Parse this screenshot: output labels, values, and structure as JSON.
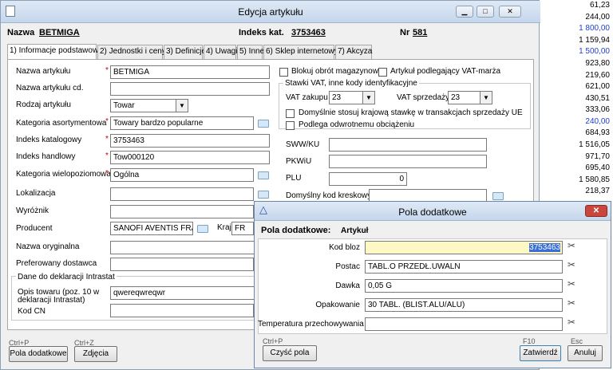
{
  "background": {
    "numbers": [
      "61,23",
      "244,00",
      "1 800,00",
      "1 159,94",
      "1 500,00",
      "923,80",
      "219,60",
      "621,00",
      "430,51",
      "333,06",
      "240,00",
      "684,93",
      "1 516,05",
      "971,70",
      "695,40",
      "1 580,85",
      "218,37"
    ],
    "blue_indices": [
      2,
      4,
      10
    ]
  },
  "main": {
    "title": "Edycja artykułu",
    "header": {
      "name_label": "Nazwa",
      "name_value": "BETMIGA",
      "index_label": "Indeks kat.",
      "index_value": "3753463",
      "nr_label": "Nr",
      "nr_value": "581"
    },
    "tabs": [
      "1) Informacje podstawowe",
      "2) Jednostki i ceny",
      "3) Definicje",
      "4) Uwagi",
      "5) Inne",
      "6) Sklep internetowy",
      "7) Akcyza"
    ],
    "fields": {
      "nazwa_label": "Nazwa artykułu",
      "nazwa_value": "BETMIGA",
      "nazwa_cd_label": "Nazwa artykułu cd.",
      "nazwa_cd_value": "",
      "rodzaj_label": "Rodzaj artykułu",
      "rodzaj_value": "Towar",
      "kategoria_label": "Kategoria asortymentowa",
      "kategoria_value": "Towary bardzo popularne",
      "indeks_kat_label": "Indeks katalogowy",
      "indeks_kat_value": "3753463",
      "indeks_han_label": "Indeks handlowy",
      "indeks_han_value": "Tow000120",
      "kat_wielo_label": "Kategoria wielopoziomowa",
      "kat_wielo_value": "Ogólna",
      "lokalizacja_label": "Lokalizacja",
      "wyroznik_label": "Wyróżnik",
      "producent_label": "Producent",
      "producent_value": "SANOFI AVENTIS FRAN",
      "kraj_label": "Kraj",
      "kraj_value": "FR",
      "nazwa_oryg_label": "Nazwa oryginalna",
      "pref_dost_label": "Preferowany dostawca",
      "intrastat_group": "Dane do deklaracji Intrastat",
      "opis_label": "Opis towaru (poz. 10 w deklaracji Intrastat)",
      "opis_value": "qwereqwreqwr",
      "kodcn_label": "Kod CN"
    },
    "right": {
      "blokuj": "Blokuj obrót magazynowy",
      "vat_marza": "Artykuł podlegający VAT-marża",
      "stawki_group": "Stawki VAT, inne kody identyfikacyjne",
      "vat_zak_label": "VAT zakupu",
      "vat_zak_value": "23",
      "vat_sprz_label": "VAT sprzedaży",
      "vat_sprz_value": "23",
      "domyslnie": "Domyślnie stosuj krajową stawkę w transakcjach sprzedaży UE",
      "odwrotne": "Podlega odwrotnemu obciążeniu",
      "sww_label": "SWW/KU",
      "pkwiu_label": "PKWiU",
      "plu_label": "PLU",
      "plu_value": "0",
      "kod_kresk_label": "Domyślny kod kreskowy"
    },
    "footer": {
      "shortcut1": "Ctrl+P",
      "btn1": "Pola dodatkowe",
      "shortcut2": "Ctrl+Z",
      "btn2": "Zdjęcia"
    }
  },
  "dialog": {
    "title": "Pola dodatkowe",
    "header_label": "Pola dodatkowe:",
    "header_value": "Artykuł",
    "rows": [
      {
        "label": "Kod bloz",
        "value": "3753463"
      },
      {
        "label": "Postac",
        "value": "TABL.O PRZEDŁ.UWALN"
      },
      {
        "label": "Dawka",
        "value": "0,05 G"
      },
      {
        "label": "Opakowanie",
        "value": "30 TABL. (BLIST.ALU/ALU)"
      },
      {
        "label": "Temperatura przechowywania",
        "value": ""
      }
    ],
    "footer": {
      "shortcut_clear": "Ctrl+P",
      "clear": "Czyść pola",
      "shortcut_ok": "F10",
      "ok": "Zatwierdź",
      "shortcut_cancel": "Esc",
      "cancel": "Anuluj"
    }
  }
}
